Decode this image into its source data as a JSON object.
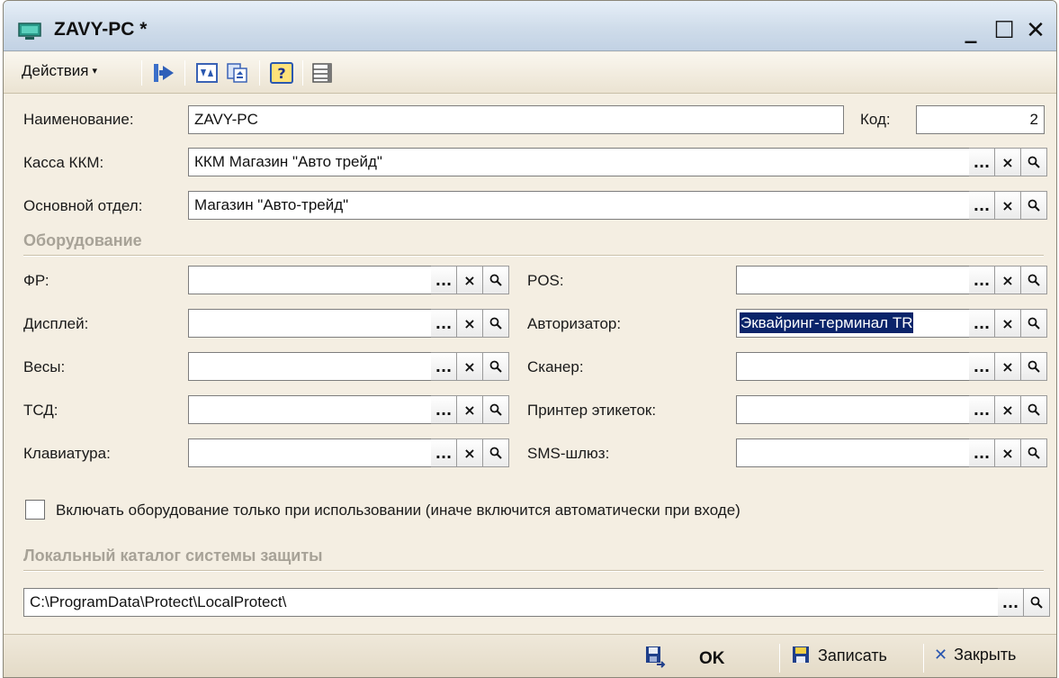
{
  "window": {
    "title": "ZAVY-PC *"
  },
  "toolbar": {
    "actions_label": "Действия",
    "actions_arrow": "▾"
  },
  "form": {
    "name": {
      "label": "Наименование:",
      "value": "ZAVY-PC"
    },
    "code": {
      "label": "Код:",
      "value": "2"
    },
    "kkm": {
      "label": "Касса ККМ:",
      "value": "ККМ Магазин \"Авто трейд\""
    },
    "department": {
      "label": "Основной отдел:",
      "value": "Магазин \"Авто-трейд\""
    }
  },
  "equipment": {
    "section_title": "Оборудование",
    "left": [
      {
        "label": "ФР:",
        "value": ""
      },
      {
        "label": "Дисплей:",
        "value": ""
      },
      {
        "label": "Весы:",
        "value": ""
      },
      {
        "label": "ТСД:",
        "value": ""
      },
      {
        "label": "Клавиатура:",
        "value": ""
      }
    ],
    "right": [
      {
        "label": "POS:",
        "value": ""
      },
      {
        "label": "Авторизатор:",
        "value": "Эквайринг-терминал TR"
      },
      {
        "label": "Сканер:",
        "value": ""
      },
      {
        "label": "Принтер этикеток:",
        "value": ""
      },
      {
        "label": "SMS-шлюз:",
        "value": ""
      }
    ],
    "checkbox_label": "Включать оборудование только при использовании (иначе включится автоматически при входе)",
    "checkbox_checked": false
  },
  "protection": {
    "section_title": "Локальный каталог системы защиты",
    "path": "C:\\ProgramData\\Protect\\LocalProtect\\"
  },
  "buttons": {
    "select": "...",
    "clear": "×",
    "open": "⚲"
  },
  "footer": {
    "ok_label": "OK",
    "save_label": "Записать",
    "close_label": "Закрыть"
  },
  "colors": {
    "window_bg": "#f4eee2",
    "selection": "#0a246a",
    "section_text": "#a7a297"
  }
}
